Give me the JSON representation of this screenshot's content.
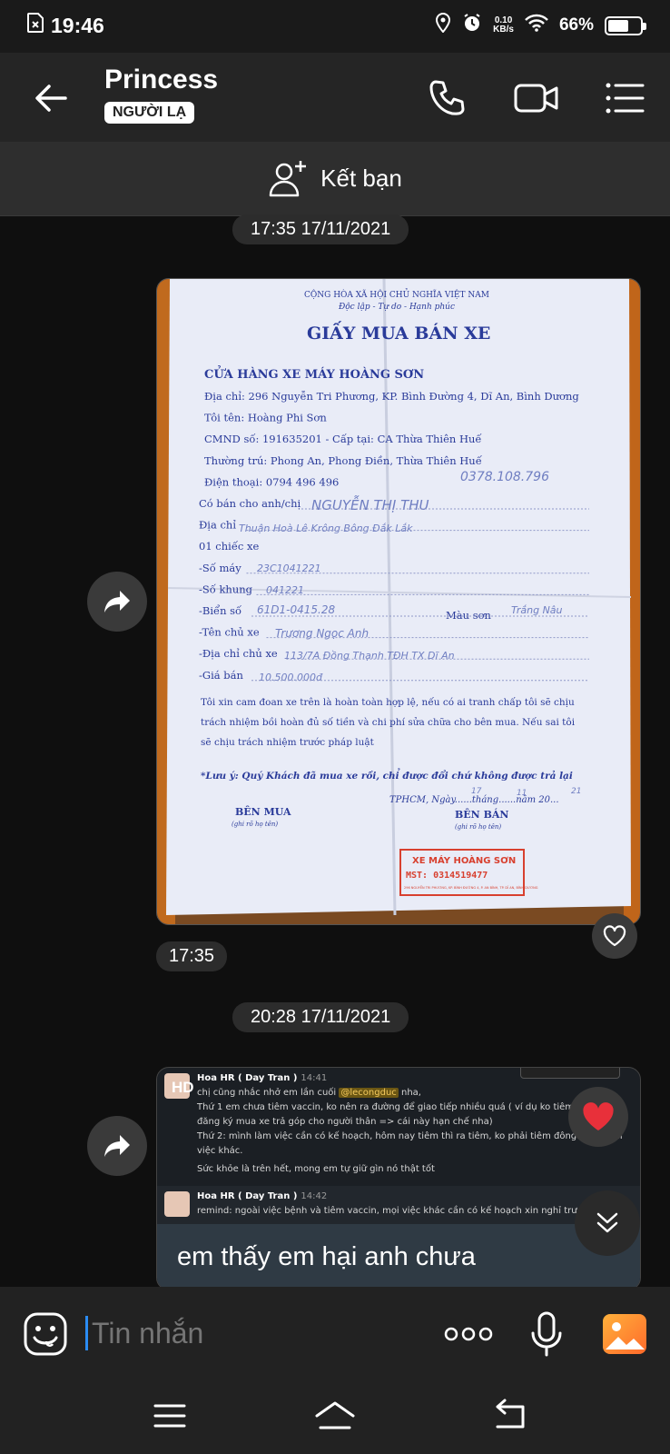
{
  "status_bar": {
    "time": "19:46",
    "speed_value": "0.10",
    "speed_unit": "KB/s",
    "battery": "66%",
    "battery_level": 0.66
  },
  "header": {
    "title": "Princess",
    "badge": "NGƯỜI LẠ"
  },
  "add_friend": {
    "label": "Kết bạn"
  },
  "messages": [
    {
      "timestamp_chip": "17:35 17/11/2021",
      "type": "image",
      "sent_time": "17:35"
    },
    {
      "timestamp_chip": "20:28 17/11/2021",
      "type": "image",
      "caption": "em thấy em hại anh chưa"
    }
  ],
  "receipt": {
    "republic": "CỘNG HÒA XÃ HỘI CHỦ NGHĨA VIỆT NAM",
    "motto": "Độc lập - Tự do - Hạnh phúc",
    "title": "GIẤY MUA BÁN XE",
    "shop": "CỬA HÀNG XE MÁY HOÀNG SƠN",
    "lines": [
      "Địa chỉ: 296 Nguyễn Tri Phương, KP. Bình Đường 4, Dĩ An, Bình Dương",
      "Tôi tên: Hoàng Phi Sơn",
      "CMND số: 191635201 - Cấp tại: CA Thừa Thiên Huế",
      "Thường trú: Phong An, Phong Điền, Thừa Thiên Huế",
      "Điện thoại: 0794 496 496",
      "Có bán cho anh/chị",
      "Địa chỉ",
      "01 chiếc xe",
      "-Số máy",
      "-Số khung",
      "-Biển số",
      "-Tên chủ xe",
      "-Địa chỉ chủ xe",
      "-Giá bán"
    ],
    "mau_son": "Màu sơn",
    "commitment": "Tôi xin cam đoan xe trên là hoàn toàn hợp lệ, nếu có ai tranh chấp tôi sẽ chịu trách nhiệm bồi hoàn đủ số tiền và chi phí sửa chữa cho bên mua. Nếu sai tôi sẽ chịu trách nhiệm trước pháp luật",
    "note": "*Lưu ý: Quý Khách đã mua xe rồi, chỉ được đổi chứ không được trả lại",
    "date_line": "TPHCM, Ngày......tháng......năm 20...",
    "buyer": "BÊN MUA",
    "buyer_sub": "(ghi rõ họ tên)",
    "seller": "BÊN BÁN",
    "seller_sub": "(ghi rõ họ tên)",
    "stamp_title": "XE MÁY HOÀNG SƠN",
    "stamp_mst": "MST: 0314519477",
    "stamp_addr": "296 NGUYỄN TRI PHƯƠNG, KP. BÌNH ĐƯỜNG 4, P. AN BÌNH, TP. DĨ AN, BÌNH DƯƠNG",
    "handwritten": {
      "phone": "0378.108.796",
      "buyer_name": "NGUYỄN THỊ THU",
      "address": "Thuận Hoà Lê Krông Bông Đắk Lắk",
      "engine_no": "23C1041221",
      "frame_no": "041221",
      "plate": "61D1-0415.28",
      "color": "Trắng Nâu",
      "owner": "Trương Ngọc Anh",
      "owner_addr": "113/7A Đồng Thạnh TĐH TX Dĩ An",
      "price": "10.500.000đ",
      "day": "17",
      "month": "11",
      "year": "21"
    }
  },
  "slack": {
    "msg1": {
      "avatar_label": "HD",
      "name": "Hoa HR ( Day Tran )",
      "time": "14:41",
      "intro": "chị cũng nhắc nhở em lần cuối",
      "mention": "@lecongduc",
      "intro_end": "nha,",
      "line1": "Thứ 1 em chưa tiêm vaccin, ko nên ra đường để giao tiếp nhiều quá ( ví dụ ko tiêm đc vẫn đi đăng ký mua xe trả góp cho người thân => cái này hạn chế nha)",
      "line2": "Thứ 2: mình làm việc cần có kế hoạch, hôm nay tiêm thì ra tiêm, ko phải tiêm đông quá thì đi việc khác.",
      "line3": "Sức khỏe là trên hết, mong em tự giữ gìn nó thật tốt"
    },
    "msg2": {
      "name": "Hoa HR ( Day Tran )",
      "time": "14:42",
      "text": "remind: ngoài việc bệnh và tiêm vaccin, mọi việc khác cần có kế hoạch xin nghỉ trước"
    }
  },
  "composer": {
    "placeholder": "Tin nhắn"
  },
  "colors": {
    "accent": "#2b8cf3",
    "background": "#0f0f0f",
    "header": "#252525"
  }
}
